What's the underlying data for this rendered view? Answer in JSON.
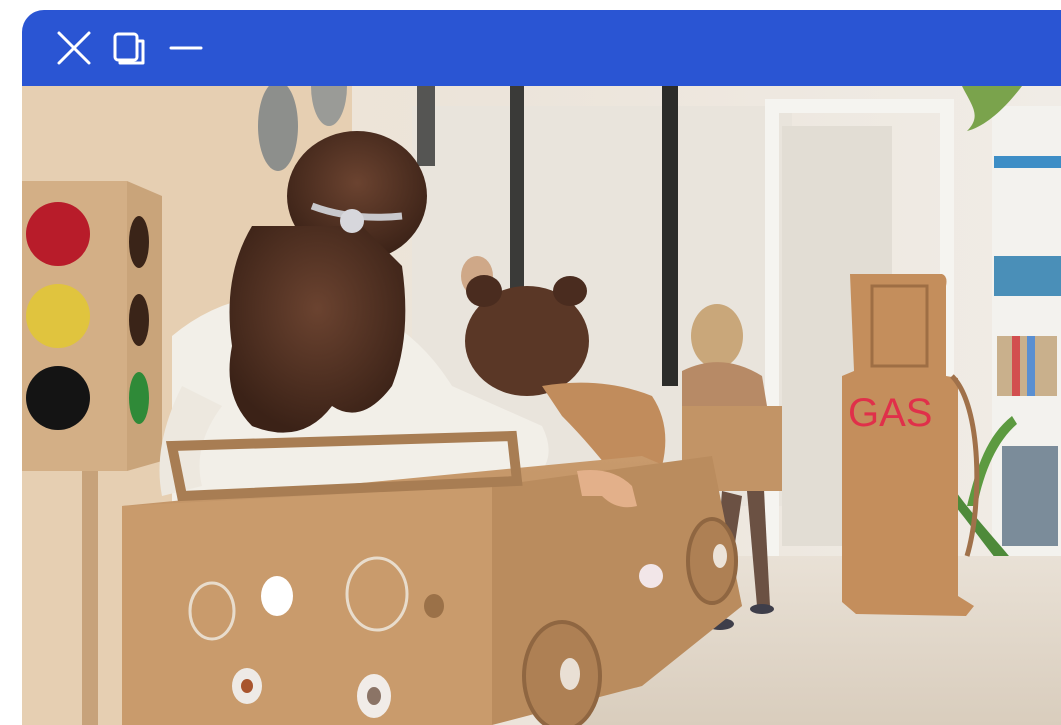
{
  "window": {
    "controls": [
      {
        "name": "close",
        "icon": "close-icon"
      },
      {
        "name": "maximize",
        "icon": "restore-icon"
      },
      {
        "name": "minimize",
        "icon": "minimize-icon"
      }
    ],
    "titlebar_color": "#2a55d3"
  },
  "photo": {
    "subject": "children-playing-with-cardboard-cars",
    "sign_text": "GAS"
  }
}
